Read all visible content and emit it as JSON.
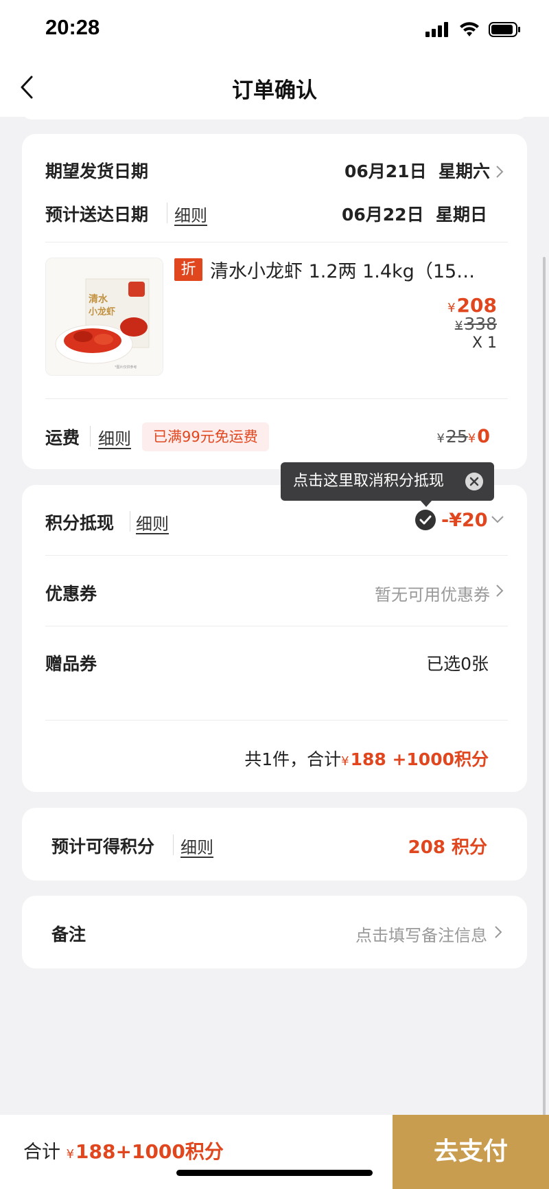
{
  "status_bar": {
    "time": "20:28"
  },
  "header": {
    "title": "订单确认"
  },
  "delivery": {
    "expected_ship_label": "期望发货日期",
    "expected_ship_value": "06月21日  星期六",
    "estimated_arrival_label": "预计送达日期",
    "estimated_arrival_rules": "细则",
    "estimated_arrival_value": "06月22日  星期日"
  },
  "product": {
    "badge": "折",
    "name": "清水小龙虾 1.2两 1.4kg（15…",
    "currency": "¥",
    "price": "208",
    "original_price": "338",
    "quantity": "X 1",
    "image_text": "清水\n小龙虾"
  },
  "shipping": {
    "label": "运费",
    "rules": "细则",
    "free_tag": "已满99元免运费",
    "original_fee": "25",
    "fee": "0"
  },
  "tooltip": {
    "text": "点击这里取消积分抵现"
  },
  "points_deduction": {
    "label": "积分抵现",
    "rules": "细则",
    "value": "-¥20"
  },
  "coupon": {
    "label": "优惠券",
    "value": "暂无可用优惠券"
  },
  "gift_coupon": {
    "label": "赠品券",
    "value": "已选0张"
  },
  "summary": {
    "prefix": "共1件，合计",
    "total": "188 +1000积分"
  },
  "estimated_points": {
    "label": "预计可得积分",
    "rules": "细则",
    "value": "208 积分"
  },
  "remark": {
    "label": "备注",
    "placeholder": "点击填写备注信息"
  },
  "bottom_bar": {
    "total_label": "合计",
    "currency": "¥",
    "total_value": "188+1000积分",
    "pay_button": "去支付"
  },
  "colors": {
    "accent_red": "#e0471f",
    "pay_gold": "#c99d4f",
    "tooltip_bg": "#3d3d3f"
  }
}
